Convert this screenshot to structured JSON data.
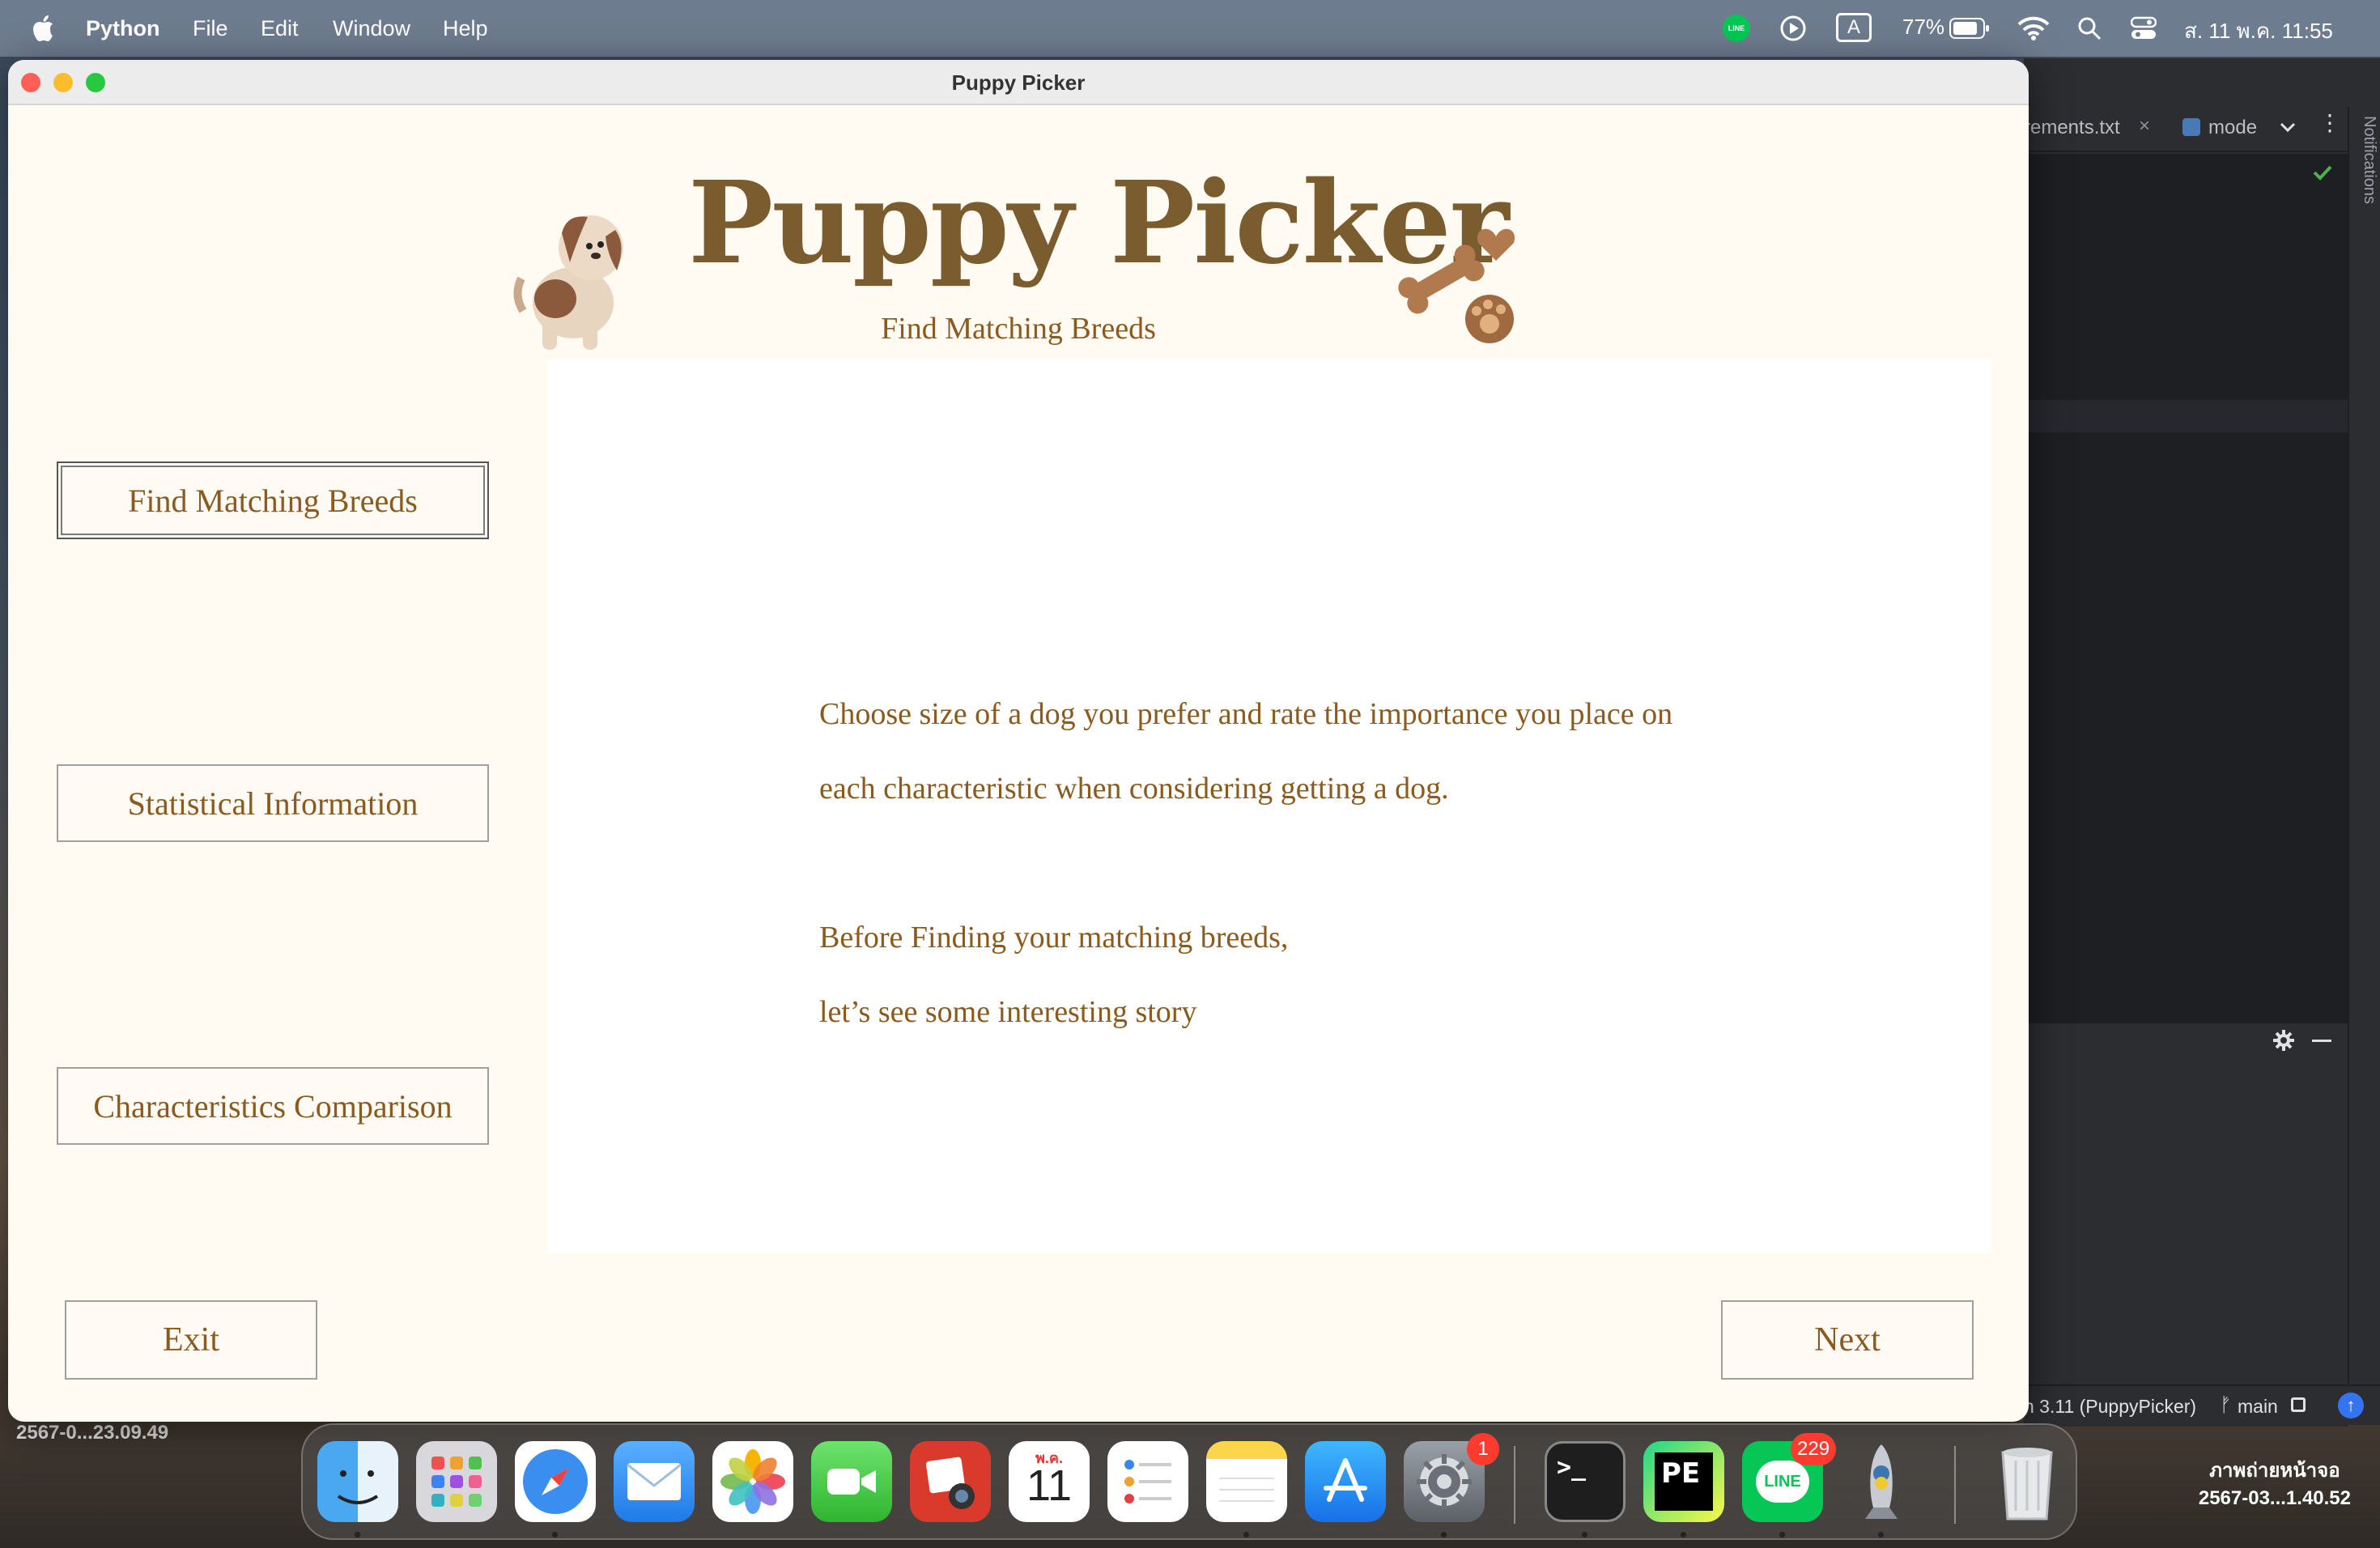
{
  "menubar": {
    "app_name": "Python",
    "items": [
      "File",
      "Edit",
      "Window",
      "Help"
    ],
    "status": {
      "line_label": "LINE",
      "input_source": "A",
      "battery": "77%",
      "datetime": "ส. 11 พ.ค.  11:55"
    }
  },
  "window": {
    "title": "Puppy Picker",
    "app_title": "Puppy Picker",
    "subtitle": "Find Matching Breeds",
    "sidebar": [
      {
        "label": "Find Matching Breeds",
        "active": true
      },
      {
        "label": "Statistical Information",
        "active": false
      },
      {
        "label": "Characteristics Comparison",
        "active": false
      }
    ],
    "content": {
      "lines": [
        "Choose size of a dog you prefer and rate the importance you place on",
        "each characteristic when considering getting a dog.",
        "Before Finding your matching breeds,",
        "let’s see some interesting story"
      ]
    },
    "exit_label": "Exit",
    "next_label": "Next"
  },
  "ide": {
    "tab1": "rements.txt",
    "tab2": "mode",
    "notifications": "Notifications",
    "interpreter": "n 3.11 (PuppyPicker)",
    "branch": "main"
  },
  "desktop": {
    "left_file": "2567-0...23.09.49",
    "screenshot_title": "ภาพถ่ายหน้าจอ",
    "screenshot_name": "2567-03...1.40.52"
  },
  "dock": {
    "calendar_month": "พ.ค.",
    "calendar_day": "11",
    "settings_badge": "1",
    "line_badge": "229",
    "terminal_glyph": ">_",
    "pycharm_label": "PE",
    "line_label": "LINE"
  },
  "colors": {
    "accent_text": "#8a5a1e",
    "title_brown": "#7a5c2e",
    "window_bg": "#fffaf2"
  }
}
